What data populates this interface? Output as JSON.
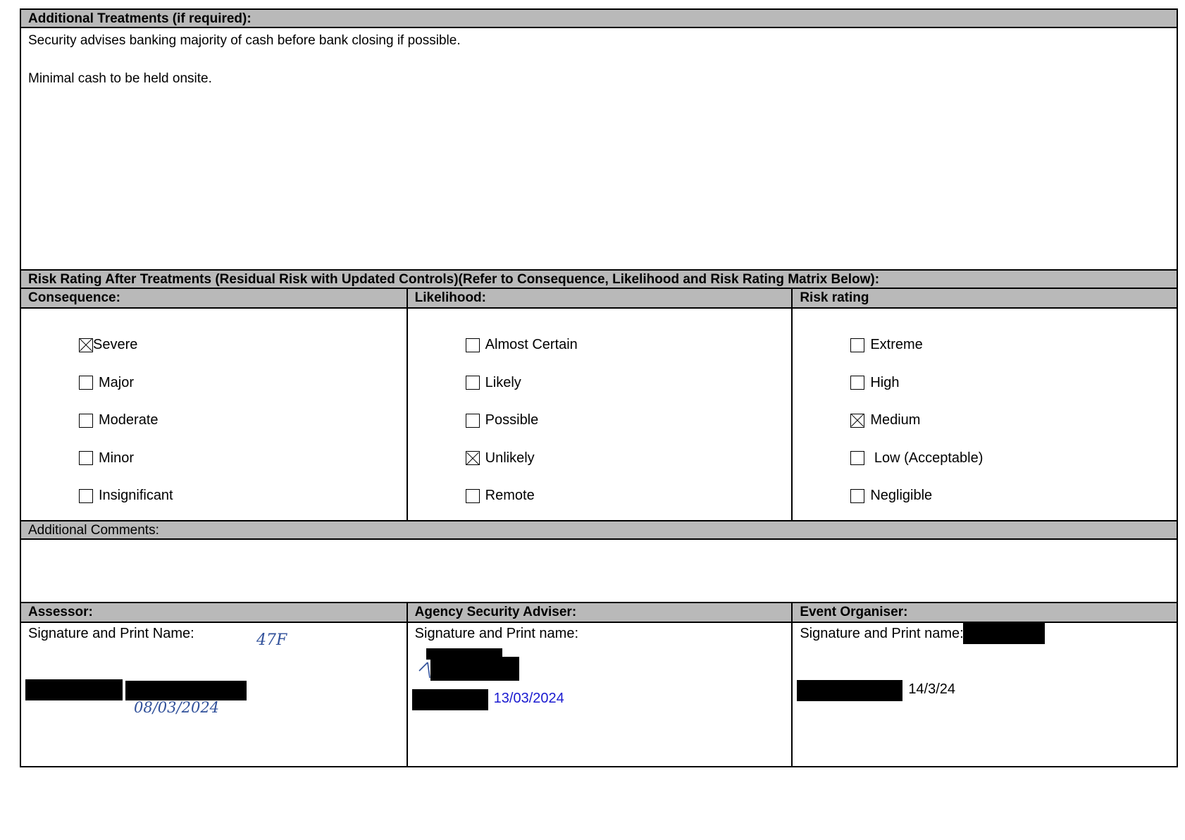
{
  "additional_treatments": {
    "header": "Additional Treatments (if required):",
    "line1": "Security advises banking majority of cash before bank closing if possible.",
    "line2": "Minimal cash to be held onsite."
  },
  "risk_rating": {
    "header": "Risk Rating After Treatments (Residual Risk with Updated Controls)(Refer to Consequence, Likelihood and Risk Rating Matrix Below):",
    "consequence": {
      "label": "Consequence:",
      "options": [
        {
          "label": "Severe",
          "checked": true
        },
        {
          "label": "Major",
          "checked": false
        },
        {
          "label": "Moderate",
          "checked": false
        },
        {
          "label": "Minor",
          "checked": false
        },
        {
          "label": "Insignificant",
          "checked": false
        }
      ]
    },
    "likelihood": {
      "label": "Likelihood:",
      "options": [
        {
          "label": "Almost Certain",
          "checked": false
        },
        {
          "label": "Likely",
          "checked": false
        },
        {
          "label": "Possible",
          "checked": false
        },
        {
          "label": "Unlikely",
          "checked": true
        },
        {
          "label": "Remote",
          "checked": false
        }
      ]
    },
    "rating": {
      "label": "Risk rating",
      "options": [
        {
          "label": "Extreme",
          "checked": false
        },
        {
          "label": "High",
          "checked": false
        },
        {
          "label": "Medium",
          "checked": true
        },
        {
          "label": " Low (Acceptable)",
          "checked": false
        },
        {
          "label": "Negligible",
          "checked": false
        }
      ]
    }
  },
  "comments": {
    "header": "Additional Comments:"
  },
  "signatures": {
    "assessor": {
      "header": "Assessor:",
      "prompt": "Signature and Print Name:",
      "initials": "47F",
      "date": "08/03/2024"
    },
    "adviser": {
      "header": "Agency Security Adviser:",
      "prompt": "Signature and Print name:",
      "date": "13/03/2024"
    },
    "organiser": {
      "header": "Event Organiser:",
      "prompt": "Signature and Print name:",
      "date": "14/3/24"
    }
  }
}
